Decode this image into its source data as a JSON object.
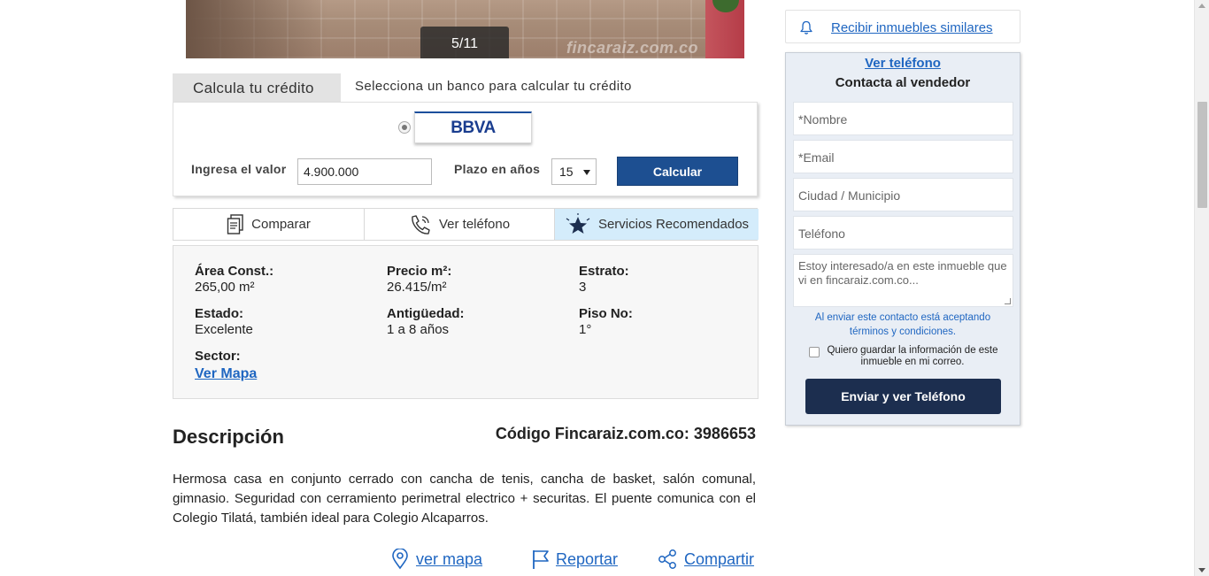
{
  "gallery": {
    "counter": "5/11",
    "watermark": "fincaraiz.com.co"
  },
  "credit": {
    "tab_label": "Calcula tu crédito",
    "subtitle": "Selecciona un banco para calcular tu crédito",
    "bank_name": "BBVA",
    "value_label": "Ingresa el valor",
    "value": "4.900.000",
    "term_label": "Plazo en años",
    "term_value": "15",
    "calc_button": "Calcular"
  },
  "actions": {
    "compare": "Comparar",
    "phone": "Ver teléfono",
    "services": "Servicios Recomendados"
  },
  "features": {
    "area_label": "Área Const.:",
    "area_value": "265,00 m²",
    "price_label": "Precio m²:",
    "price_value": "26.415/m²",
    "estrato_label": "Estrato:",
    "estrato_value": "3",
    "estado_label": "Estado:",
    "estado_value": "Excelente",
    "antiguedad_label": "Antigüedad:",
    "antiguedad_value": "1 a 8 años",
    "piso_label": "Piso No:",
    "piso_value": "1°",
    "sector_label": "Sector:",
    "sector_link": "Ver Mapa"
  },
  "description": {
    "title": "Descripción",
    "code": "Código Fincaraiz.com.co: 3986653",
    "text": "Hermosa casa en conjunto cerrado con cancha de tenis, cancha de basket, salón comunal, gimnasio. Seguridad con cerramiento perimetral electrico + securitas. El puente comunica con el Colegio Tilatá, también ideal para Colegio Alcaparros."
  },
  "bottom_links": {
    "map": "ver mapa",
    "report": "Reportar",
    "share": "Compartir"
  },
  "sidebar": {
    "similar": "Recibir inmuebles similares",
    "contact": {
      "see_phone": "Ver teléfono",
      "title": "Contacta al vendedor",
      "name_placeholder": "*Nombre",
      "email_placeholder": "*Email",
      "city_placeholder": "Ciudad / Municipio",
      "phone_placeholder": "Teléfono",
      "message_placeholder": "Estoy interesado/a en este inmueble que vi en fincaraiz.com.co...",
      "terms": "Al enviar este contacto está aceptando términos y condiciones.",
      "save_label": "Quiero guardar la información de este inmueble en mi correo.",
      "send_button": "Enviar y ver Teléfono"
    }
  },
  "colors": {
    "link": "#1f66c1",
    "primary_button": "#1d4f91",
    "send_button": "#1c2e4f",
    "highlight_tab": "#d4ecfb"
  }
}
